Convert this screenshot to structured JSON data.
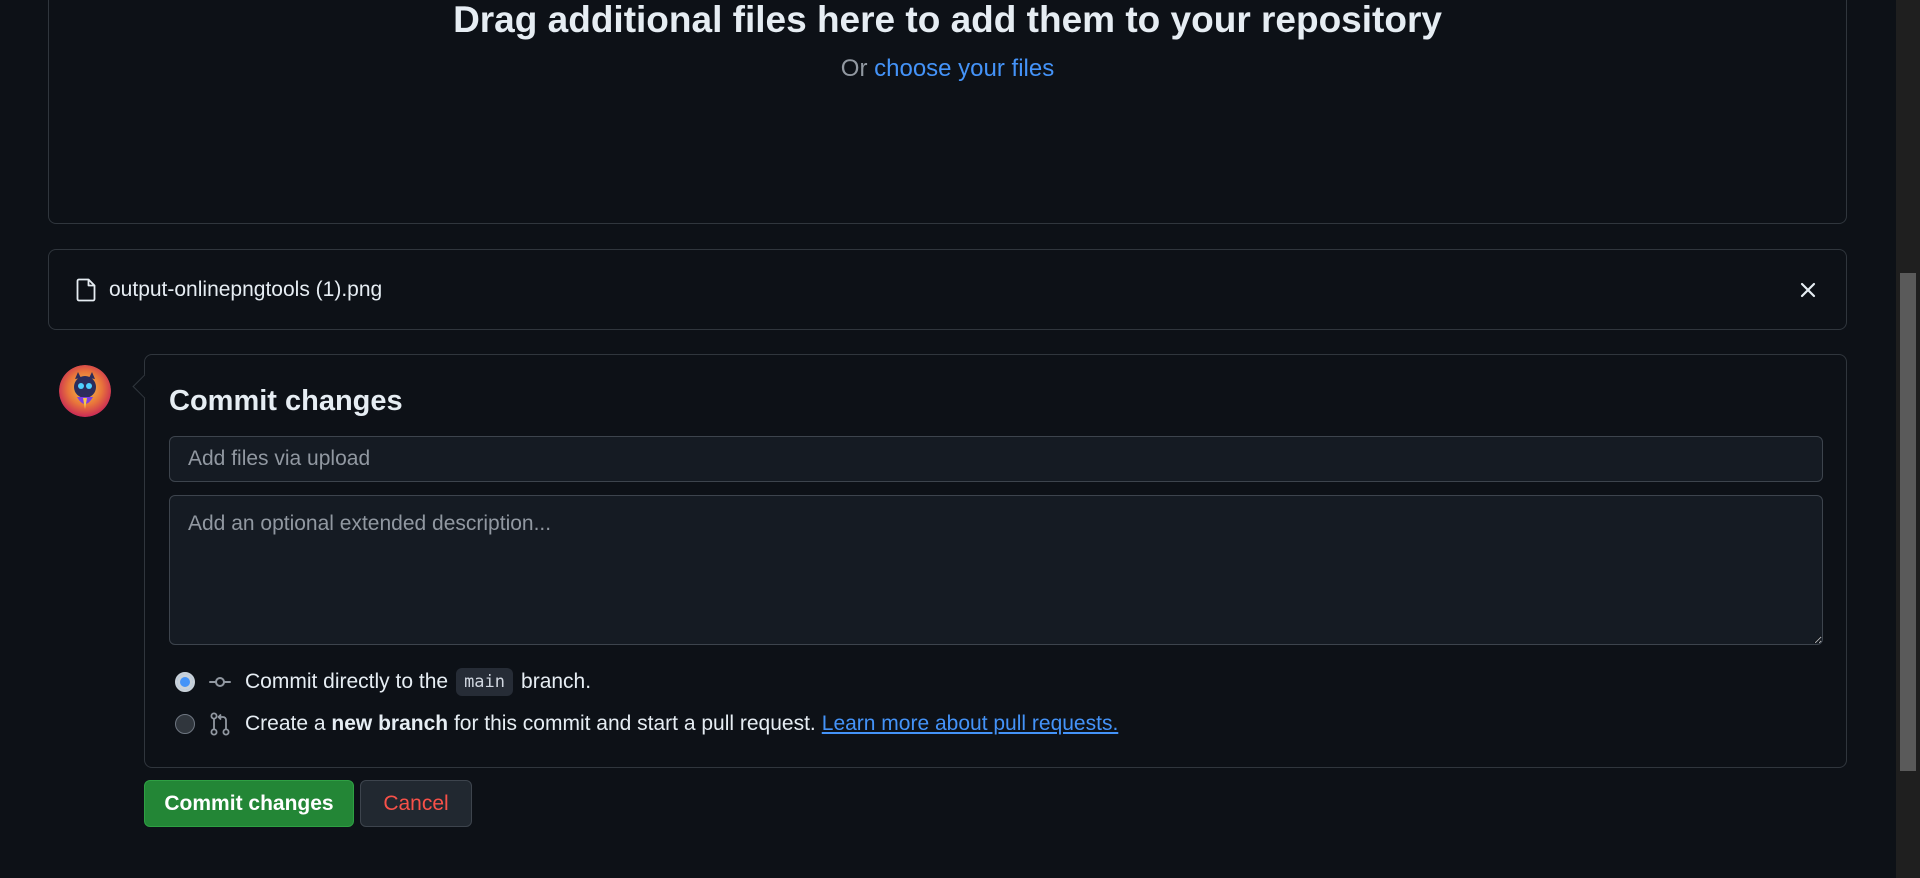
{
  "dropzone": {
    "title": "Drag additional files here to add them to your repository",
    "or_text": "Or",
    "choose_link": "choose your files"
  },
  "file": {
    "name": "output-onlinepngtools (1).png",
    "icon": "file-icon",
    "remove_icon": "close-icon"
  },
  "commit": {
    "title": "Commit changes",
    "summary_placeholder": "Add files via upload",
    "description_placeholder": "Add an optional extended description...",
    "option_direct": {
      "prefix": "Commit directly to the",
      "branch": "main",
      "suffix": "branch.",
      "checked": true
    },
    "option_new_branch": {
      "prefix": "Create a",
      "bold": "new branch",
      "suffix": "for this commit and start a pull request.",
      "link": "Learn more about pull requests.",
      "checked": false
    }
  },
  "buttons": {
    "commit": "Commit changes",
    "cancel": "Cancel"
  },
  "colors": {
    "background": "#0d1117",
    "border": "#30363d",
    "link": "#4493f8",
    "primary": "#238636",
    "danger": "#f85149"
  }
}
